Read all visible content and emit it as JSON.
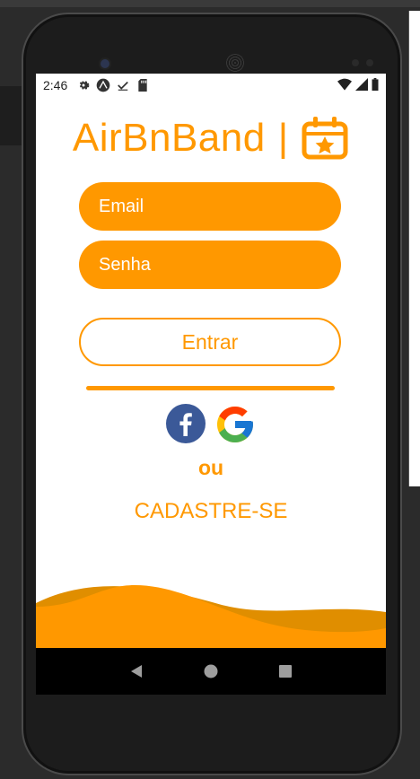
{
  "status_bar": {
    "time": "2:46"
  },
  "app": {
    "title": "AirBnBand",
    "title_separator": "|",
    "accent_color": "#ff9800",
    "title_icon": "calendar-star-icon"
  },
  "form": {
    "email_placeholder": "Email",
    "password_placeholder": "Senha",
    "enter_label": "Entrar"
  },
  "social": {
    "icons": [
      "facebook-icon",
      "google-icon"
    ]
  },
  "or_label": "ou",
  "signup_label": "CADASTRE-SE",
  "nav": {
    "icons": [
      "back-icon",
      "home-icon",
      "recents-icon"
    ]
  }
}
